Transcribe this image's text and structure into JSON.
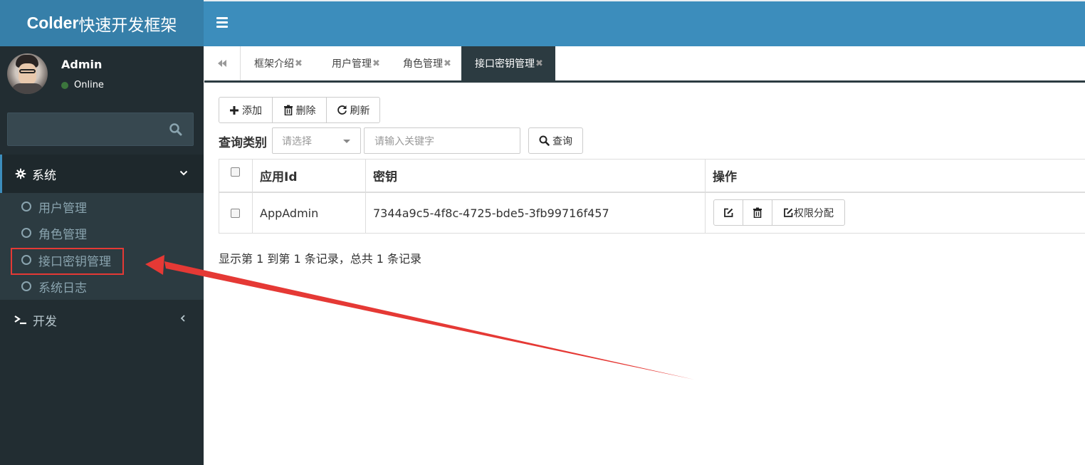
{
  "header": {
    "logo_bold": "Colder",
    "logo_rest": "快速开发框架"
  },
  "user": {
    "name": "Admin",
    "status": "Online"
  },
  "sidebar": {
    "search_placeholder": "",
    "system_label": "系统",
    "items": [
      {
        "label": "用户管理"
      },
      {
        "label": "角色管理"
      },
      {
        "label": "接口密钥管理"
      },
      {
        "label": "系统日志"
      }
    ],
    "dev_label": "开发"
  },
  "tabs": [
    {
      "label": "框架介绍",
      "close": "✖"
    },
    {
      "label": "用户管理",
      "close": "✖"
    },
    {
      "label": "角色管理",
      "close": "✖"
    },
    {
      "label": "接口密钥管理",
      "close": "✖",
      "active": true
    }
  ],
  "toolbar": {
    "add_label": "添加",
    "delete_label": "删除",
    "refresh_label": "刷新",
    "query_label": "查询类别",
    "select_placeholder": "请选择",
    "keyword_placeholder": "请输入关键字",
    "search_label": "查询"
  },
  "table": {
    "columns": [
      "应用Id",
      "密钥",
      "操作"
    ],
    "rows": [
      {
        "app_id": "AppAdmin",
        "key": "7344a9c5-4f8c-4725-bde5-3fb99716f457",
        "perm_label": "权限分配"
      }
    ]
  },
  "summary": "显示第 1 到第 1 条记录，总共 1 条记录",
  "colors": {
    "header": "#3c8dbc",
    "logo_bg": "#367fa9",
    "sidebar": "#222d32",
    "annotation": "#e53935"
  }
}
